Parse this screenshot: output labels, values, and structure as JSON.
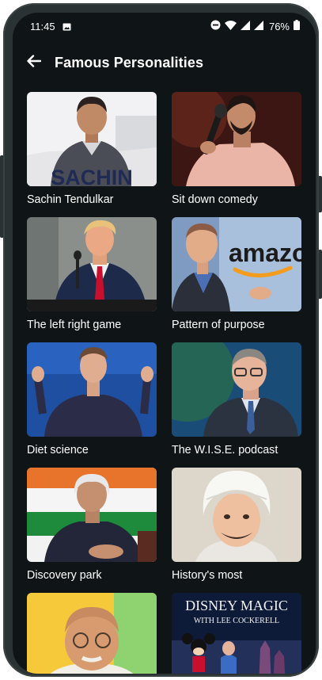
{
  "status_bar": {
    "time": "11:45",
    "battery": "76%",
    "icons": [
      "image-icon",
      "dnd-icon",
      "wifi-icon",
      "signal-icon",
      "signal-icon",
      "battery-icon"
    ]
  },
  "app_bar": {
    "back_icon": "arrow-left-icon",
    "title": "Famous Personalities"
  },
  "items": [
    {
      "label": "Sachin Tendulkar",
      "thumb_text": "SACHIN"
    },
    {
      "label": "Sit down comedy"
    },
    {
      "label": "The left right game"
    },
    {
      "label": "Pattern of purpose",
      "thumb_text": "amazon.c"
    },
    {
      "label": "Diet science"
    },
    {
      "label": "The W.I.S.E. podcast"
    },
    {
      "label": "Discovery park"
    },
    {
      "label": "History's most"
    },
    {
      "label": ""
    },
    {
      "label": "",
      "thumb_text": "DISNEY MAGIC",
      "thumb_subtext": "WITH LEE COCKERELL"
    }
  ],
  "colors": {
    "screen_bg": "#0f1517",
    "frame": "#2b3234",
    "text": "#ffffff"
  }
}
